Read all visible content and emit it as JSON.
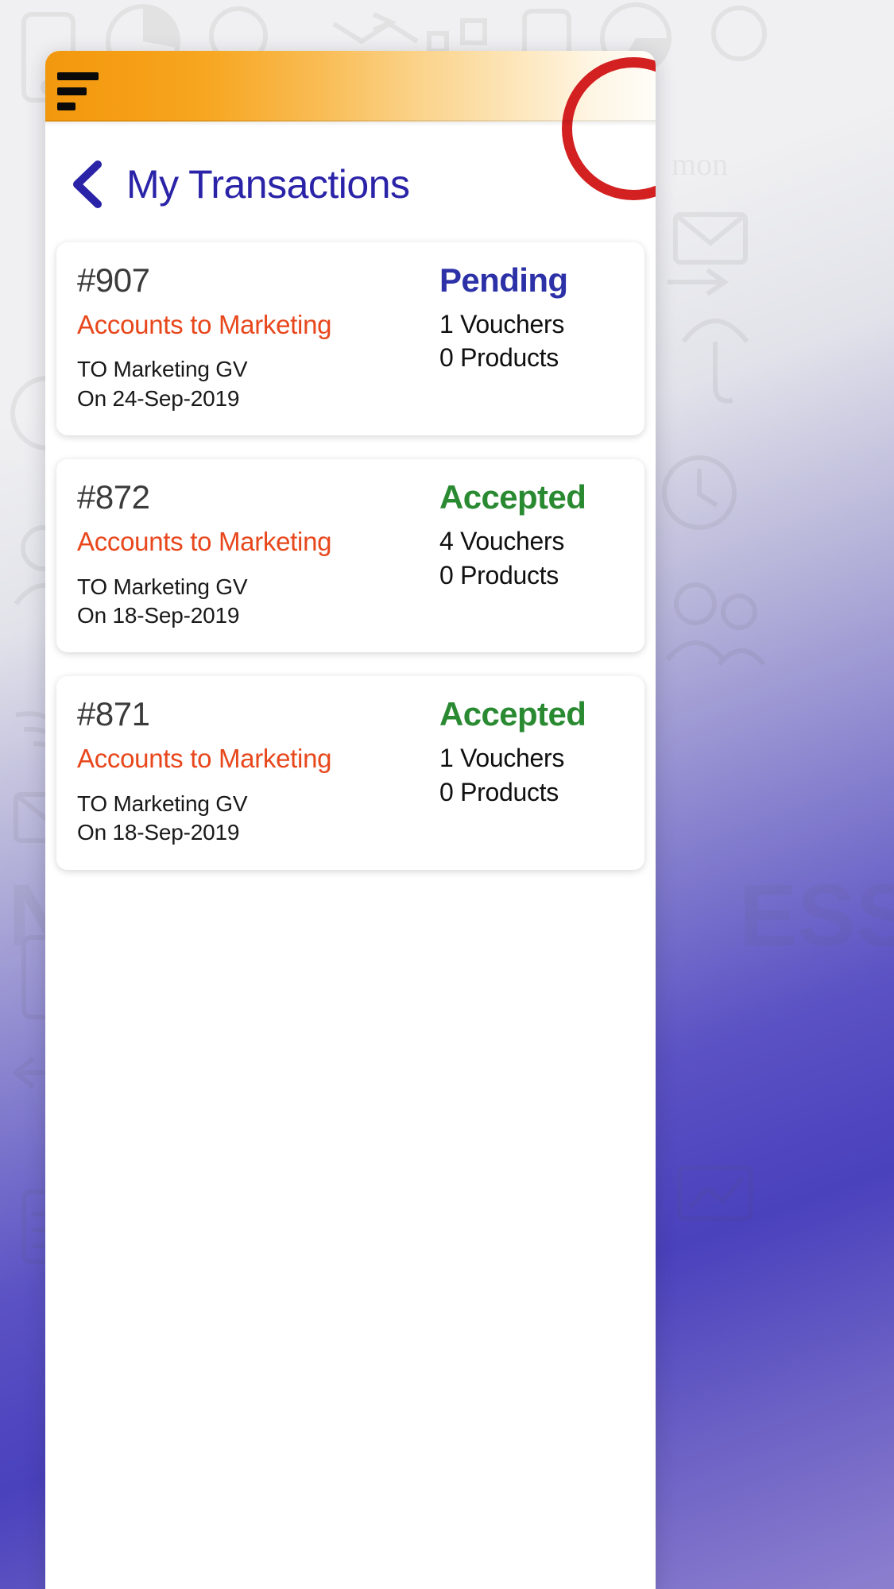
{
  "header": {
    "menu_icon": "hamburger-icon",
    "accent_orange": "#f2980e",
    "accent_red": "#d32020"
  },
  "titlebar": {
    "back_icon": "chevron-left-icon",
    "title": "My Transactions",
    "title_color": "#2a23a8"
  },
  "colors": {
    "route_orange": "#e8471c",
    "status_pending": "#2c31a8",
    "status_accepted": "#2a8a32",
    "id_gray": "#3b3b3b"
  },
  "transactions": [
    {
      "id": "#907",
      "route": "Accounts to Marketing",
      "to": "TO Marketing GV",
      "date": "On 24-Sep-2019",
      "status": "Pending",
      "vouchers": "1 Vouchers",
      "products": "0 Products"
    },
    {
      "id": "#872",
      "route": "Accounts to Marketing",
      "to": "TO Marketing GV",
      "date": "On 18-Sep-2019",
      "status": "Accepted",
      "vouchers": "4 Vouchers",
      "products": "0 Products"
    },
    {
      "id": "#871",
      "route": "Accounts to Marketing",
      "to": "TO Marketing GV",
      "date": "On 18-Sep-2019",
      "status": "Accepted",
      "vouchers": "1 Vouchers",
      "products": "0 Products"
    }
  ]
}
